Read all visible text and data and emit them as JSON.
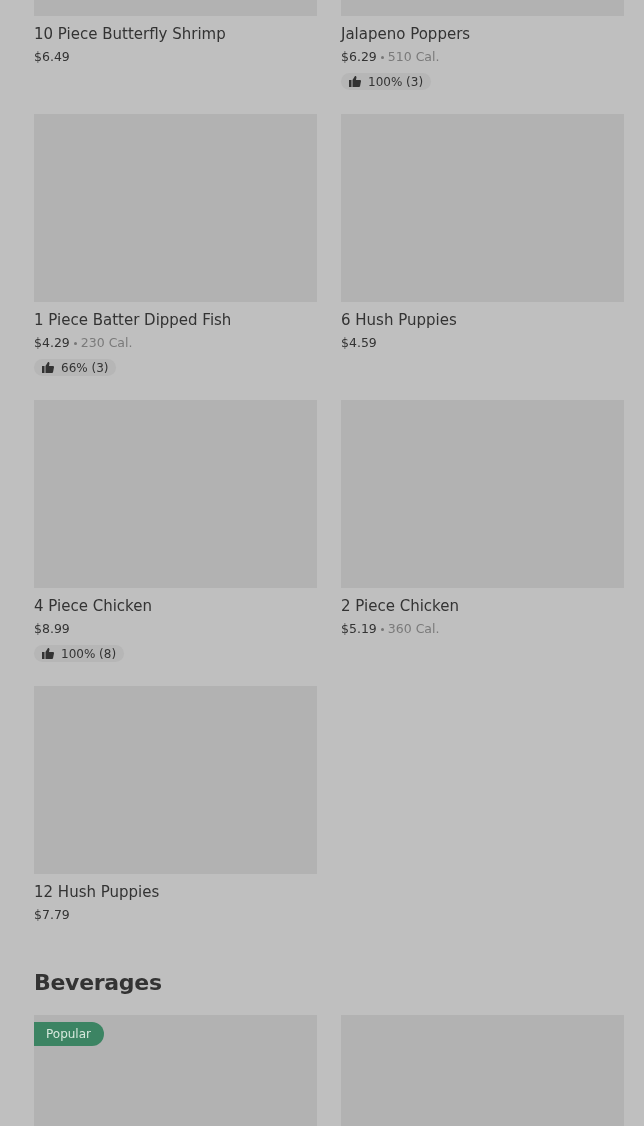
{
  "sections": [
    {
      "items": [
        {
          "kind": "card",
          "name": "10 Piece Butterfly Shrimp",
          "price": "$6.49"
        },
        {
          "kind": "card",
          "name": "Jalapeno Poppers",
          "price": "$6.29",
          "calories": "510 Cal.",
          "rating": "100% (3)"
        },
        {
          "kind": "card",
          "name": "1 Piece Batter Dipped Fish",
          "price": "$4.29",
          "calories": "230 Cal.",
          "rating": "66% (3)"
        },
        {
          "kind": "card",
          "name": "6 Hush Puppies",
          "price": "$4.59"
        },
        {
          "kind": "card",
          "name": "4 Piece Chicken",
          "price": "$8.99",
          "rating": "100% (8)"
        },
        {
          "kind": "card",
          "name": "2 Piece Chicken",
          "price": "$5.19",
          "calories": "360 Cal."
        },
        {
          "kind": "card",
          "name": "12 Hush Puppies",
          "price": "$7.79"
        }
      ]
    },
    {
      "title": "Beverages",
      "items": [
        {
          "kind": "card",
          "badge": "Popular"
        },
        {
          "kind": "card"
        }
      ]
    }
  ]
}
